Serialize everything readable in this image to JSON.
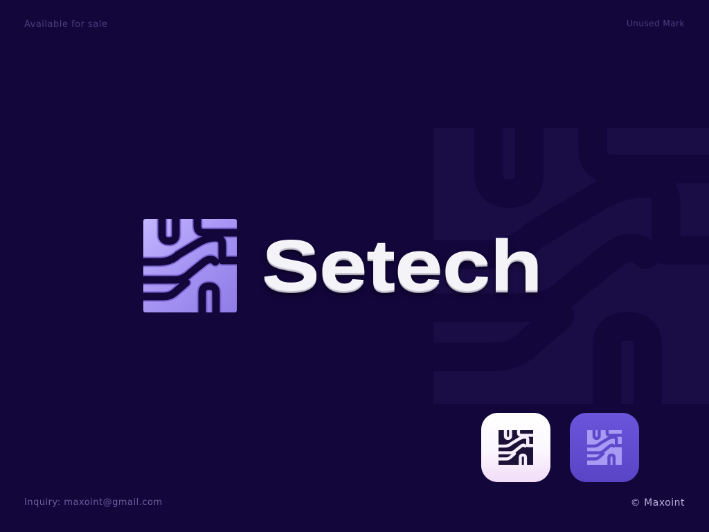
{
  "header": {
    "availability": "Available for sale",
    "mark_status": "Unused Mark"
  },
  "brand": {
    "name": "Setech",
    "mark_icon": "circuit-s-mark-icon"
  },
  "footer": {
    "inquiry": "Inquiry: maxoint@gmail.com",
    "copyright": "© Maxoint"
  },
  "app_icons": [
    {
      "variant": "light",
      "icon": "circuit-s-mark-icon"
    },
    {
      "variant": "purple",
      "icon": "circuit-s-mark-icon"
    }
  ],
  "colors": {
    "background": "#12063b",
    "mark_purple": "#a796f2",
    "wordmark": "#f4f3f8",
    "icon_dark_bg": "#5e49cd"
  }
}
